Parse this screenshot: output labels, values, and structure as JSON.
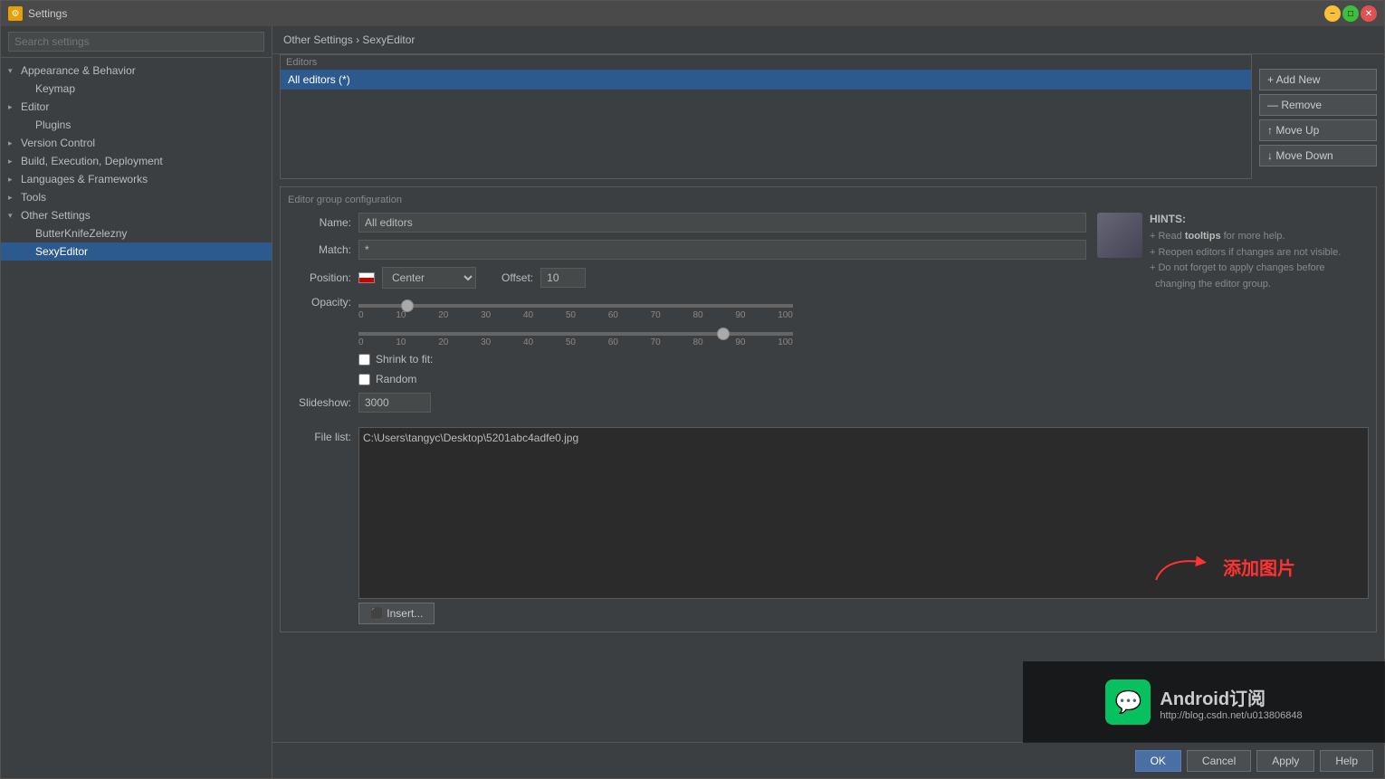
{
  "window": {
    "title": "Settings",
    "icon": "⚙"
  },
  "sidebar": {
    "search_placeholder": "Search settings",
    "items": [
      {
        "id": "appearance",
        "label": "Appearance & Behavior",
        "level": 0,
        "expandable": true,
        "expanded": true
      },
      {
        "id": "keymap",
        "label": "Keymap",
        "level": 1,
        "expandable": false
      },
      {
        "id": "editor",
        "label": "Editor",
        "level": 0,
        "expandable": true,
        "expanded": false
      },
      {
        "id": "plugins",
        "label": "Plugins",
        "level": 1,
        "expandable": false
      },
      {
        "id": "version-control",
        "label": "Version Control",
        "level": 0,
        "expandable": true,
        "expanded": false
      },
      {
        "id": "build",
        "label": "Build, Execution, Deployment",
        "level": 0,
        "expandable": true,
        "expanded": false
      },
      {
        "id": "languages",
        "label": "Languages & Frameworks",
        "level": 0,
        "expandable": true,
        "expanded": false
      },
      {
        "id": "tools",
        "label": "Tools",
        "level": 0,
        "expandable": true,
        "expanded": false
      },
      {
        "id": "other-settings",
        "label": "Other Settings",
        "level": 0,
        "expandable": true,
        "expanded": true
      },
      {
        "id": "butterknife",
        "label": "ButterKnifeZelezny",
        "level": 1,
        "expandable": false
      },
      {
        "id": "sexyeditor",
        "label": "SexyEditor",
        "level": 1,
        "expandable": false,
        "selected": true
      }
    ]
  },
  "breadcrumb": {
    "path": "Other Settings",
    "separator": " › ",
    "current": "SexyEditor"
  },
  "editors_section": {
    "title": "Editors",
    "items": [
      {
        "label": "All editors (*)",
        "selected": true
      }
    ]
  },
  "buttons": {
    "add_new": "+ Add New",
    "remove": "— Remove",
    "move_up": "↑  Move Up",
    "move_down": "↓  Move Down"
  },
  "config_section": {
    "title": "Editor group configuration",
    "name_label": "Name:",
    "name_value": "All editors",
    "match_label": "Match:",
    "match_value": "*",
    "position_label": "Position:",
    "position_value": "Center",
    "offset_label": "Offset:",
    "offset_value": "10",
    "opacity_label": "Opacity:",
    "opacity_ticks": [
      "0",
      "10",
      "20",
      "30",
      "40",
      "50",
      "60",
      "70",
      "80",
      "90",
      "100"
    ],
    "opacity_value": 10,
    "shrink_label": "Shrink to fit:",
    "shrink_checked": false,
    "random_label": "Random",
    "random_checked": false,
    "slideshow_label": "Slideshow:",
    "slideshow_value": "3000"
  },
  "hints": {
    "title": "HINTS:",
    "lines": [
      "+ Read tooltips for more help.",
      "+ Reopen editors if changes are not visible.",
      "+ Do not forget to apply changes before",
      "  changing the editor group."
    ],
    "tooltips_bold": "tooltips"
  },
  "file_list": {
    "label": "File list:",
    "path": "C:\\Users\\tangyc\\Desktop\\5201abc4adfe0.jpg",
    "annotation_text": "添加图片"
  },
  "insert_btn": "⬛ Insert...",
  "bottom_buttons": {
    "ok": "OK",
    "cancel": "Cancel",
    "apply": "Apply",
    "help": "Help"
  },
  "watermark": {
    "title": "Android订阅",
    "sub": "http://blog.csdn.net/u013806848"
  }
}
